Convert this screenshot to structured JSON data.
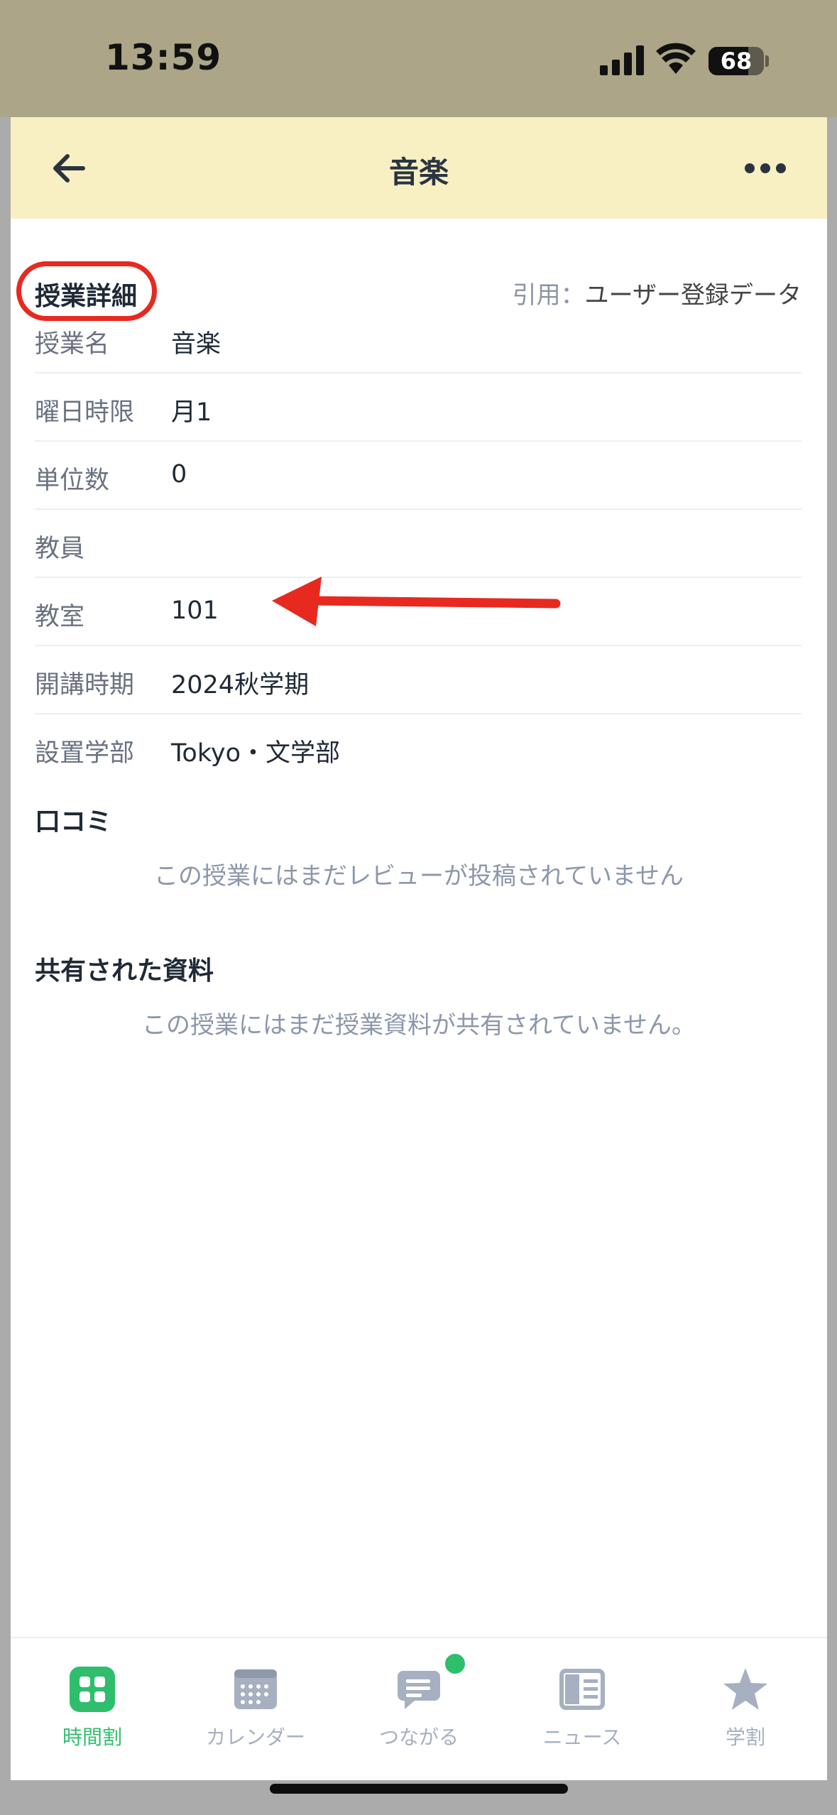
{
  "status": {
    "time": "13:59",
    "battery": "68"
  },
  "nav": {
    "title": "音楽"
  },
  "details": {
    "heading": "授業詳細",
    "source_key": "引用：",
    "source_value": "ユーザー登録データ",
    "rows": [
      {
        "label": "授業名",
        "value": "音楽"
      },
      {
        "label": "曜日時限",
        "value": "月1"
      },
      {
        "label": "単位数",
        "value": "0"
      },
      {
        "label": "教員",
        "value": ""
      },
      {
        "label": "教室",
        "value": "101"
      },
      {
        "label": "開講時期",
        "value": "2024秋学期"
      },
      {
        "label": "設置学部",
        "value": "Tokyo・文学部"
      }
    ]
  },
  "reviews": {
    "heading": "口コミ",
    "empty": "この授業にはまだレビューが投稿されていません"
  },
  "materials": {
    "heading": "共有された資料",
    "empty": "この授業にはまだ授業資料が共有されていません。"
  },
  "tabs": [
    {
      "label": "時間割",
      "icon": "timetable-icon",
      "active": true
    },
    {
      "label": "カレンダー",
      "icon": "calendar-icon"
    },
    {
      "label": "つながる",
      "icon": "chat-icon",
      "badge": true
    },
    {
      "label": "ニュース",
      "icon": "news-icon"
    },
    {
      "label": "学割",
      "icon": "star-icon"
    }
  ],
  "colors": {
    "header_bg": "#f8efc3",
    "status_bg": "#aca587",
    "active_tab": "#2fbe6c",
    "annotation": "#e8291f"
  }
}
